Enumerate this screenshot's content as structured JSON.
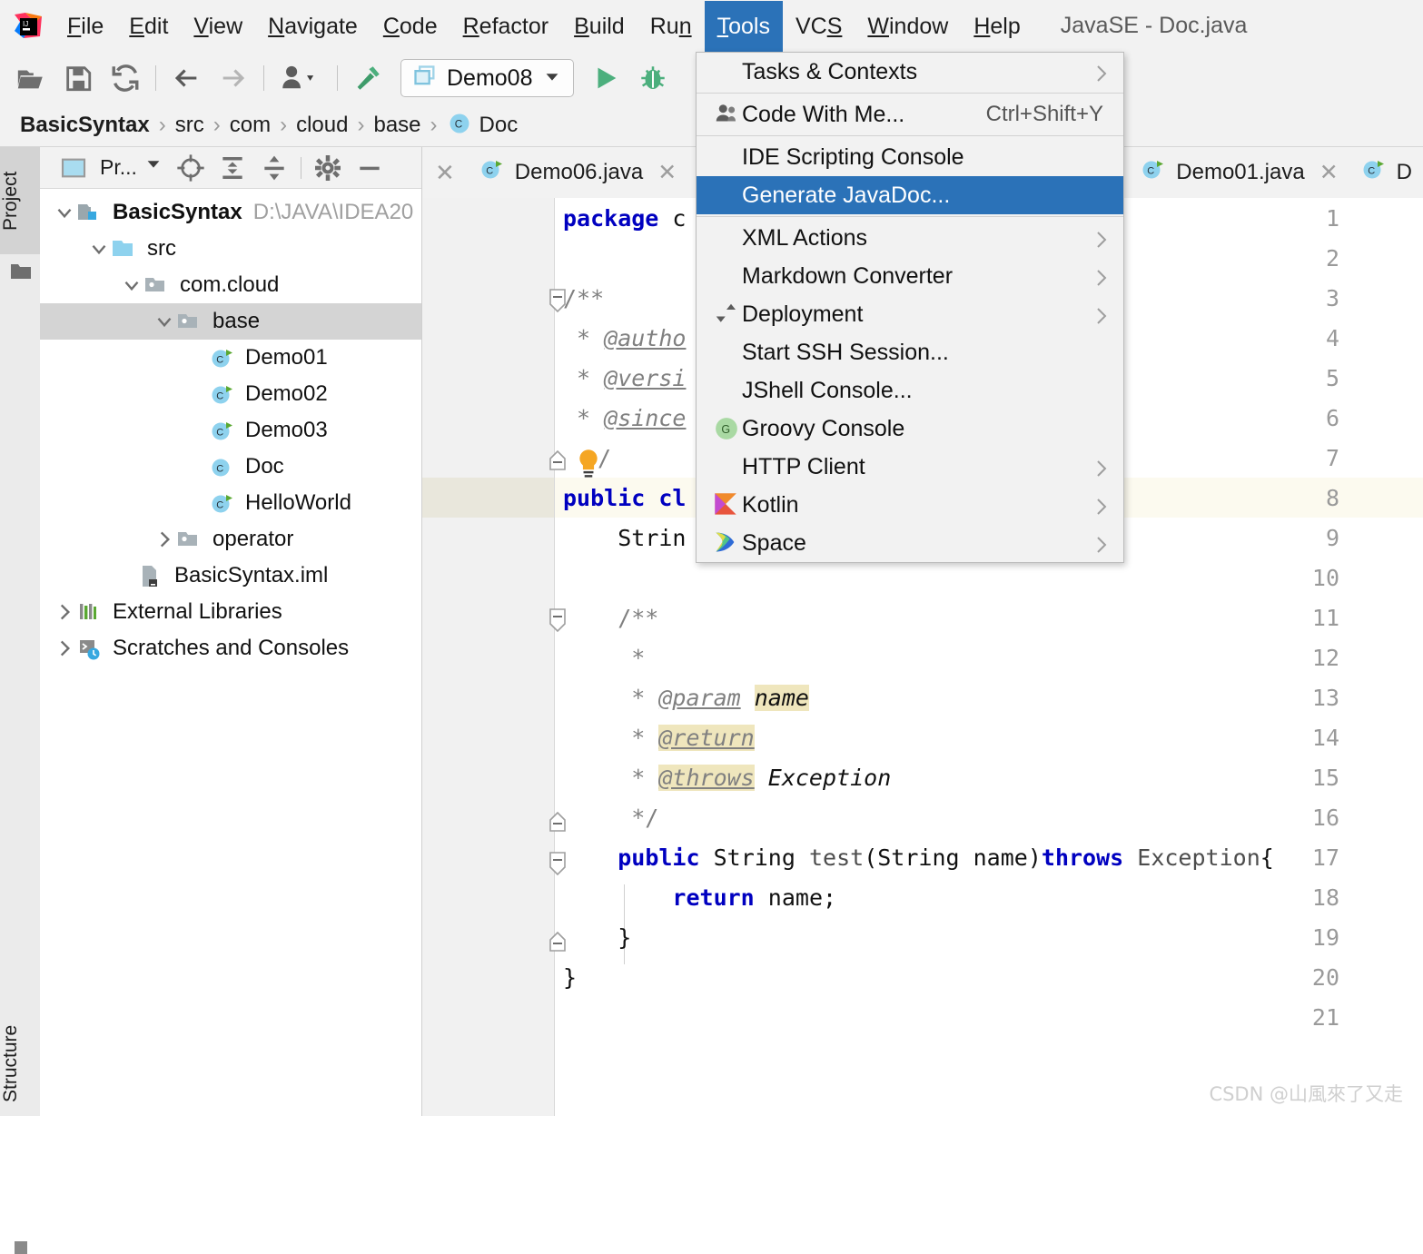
{
  "window": {
    "title": "JavaSE - Doc.java",
    "accent_color": "#8a7be0",
    "highlight_color": "#2b72b8"
  },
  "menubar": {
    "logo_icon": "intellij-idea-logo",
    "items": [
      {
        "label": "File",
        "mnemonic": "F"
      },
      {
        "label": "Edit",
        "mnemonic": "E"
      },
      {
        "label": "View",
        "mnemonic": "V"
      },
      {
        "label": "Navigate",
        "mnemonic": "N"
      },
      {
        "label": "Code",
        "mnemonic": "C"
      },
      {
        "label": "Refactor",
        "mnemonic": "R"
      },
      {
        "label": "Build",
        "mnemonic": "B"
      },
      {
        "label": "Run",
        "mnemonic": "n"
      },
      {
        "label": "Tools",
        "mnemonic": "T",
        "active": true
      },
      {
        "label": "VCS",
        "mnemonic": "S"
      },
      {
        "label": "Window",
        "mnemonic": "W"
      },
      {
        "label": "Help",
        "mnemonic": "H"
      }
    ]
  },
  "toolbar": {
    "icons": [
      "open-folder-icon",
      "save-all-icon",
      "sync-refresh-icon",
      "back-arrow-icon",
      "forward-arrow-icon",
      "profile-dropdown-icon",
      "build-hammer-icon"
    ],
    "run_config": {
      "icon": "run-configuration-icon",
      "label": "Demo08",
      "dropdown_icon": "chevron-down-icon"
    },
    "run_icon": "run-play-icon",
    "debug_icon": "debug-bug-icon"
  },
  "breadcrumb": {
    "separator": "›",
    "items": [
      {
        "label": "BasicSyntax",
        "bold": true
      },
      {
        "label": "src"
      },
      {
        "label": "com"
      },
      {
        "label": "cloud"
      },
      {
        "label": "base"
      },
      {
        "label": "Doc",
        "icon": "java-class-icon"
      }
    ]
  },
  "left_strip": {
    "project_tab": "Project",
    "structure_tab": "Structure",
    "favorites_icon": "favorites-folder-icon"
  },
  "project_panel": {
    "toolbar": {
      "view_icon": "project-view-icon",
      "view_label": "Pr...",
      "dropdown_icon": "chevron-down-icon",
      "locate_icon": "scroll-from-source-icon",
      "expand_icon": "expand-all-icon",
      "collapse_icon": "collapse-all-icon",
      "settings_icon": "gear-icon",
      "hide_icon": "minimize-icon"
    },
    "tree": [
      {
        "label": "BasicSyntax",
        "path": "D:\\JAVA\\IDEA20",
        "depth": 0,
        "arrow": "down",
        "icon": "module-folder-icon",
        "bold": true
      },
      {
        "label": "src",
        "depth": 1,
        "arrow": "down",
        "icon": "source-folder-icon"
      },
      {
        "label": "com.cloud",
        "depth": 2,
        "arrow": "down",
        "icon": "package-icon"
      },
      {
        "label": "base",
        "depth": 3,
        "arrow": "down",
        "icon": "package-icon",
        "selected": true
      },
      {
        "label": "Demo01",
        "depth": 4,
        "arrow": "none",
        "icon": "java-runnable-class-icon"
      },
      {
        "label": "Demo02",
        "depth": 4,
        "arrow": "none",
        "icon": "java-runnable-class-icon"
      },
      {
        "label": "Demo03",
        "depth": 4,
        "arrow": "none",
        "icon": "java-runnable-class-icon"
      },
      {
        "label": "Doc",
        "depth": 4,
        "arrow": "none",
        "icon": "java-class-icon"
      },
      {
        "label": "HelloWorld",
        "depth": 4,
        "arrow": "none",
        "icon": "java-runnable-class-icon"
      },
      {
        "label": "operator",
        "depth": 3,
        "arrow": "right",
        "icon": "package-icon"
      },
      {
        "label": "BasicSyntax.iml",
        "depth": 2,
        "arrow": "none",
        "icon": "iml-file-icon"
      },
      {
        "label": "External Libraries",
        "depth": 0,
        "arrow": "right",
        "icon": "libraries-icon"
      },
      {
        "label": "Scratches and Consoles",
        "depth": 0,
        "arrow": "right",
        "icon": "scratches-icon"
      }
    ]
  },
  "editor_tabs": [
    {
      "label": "Demo06.java",
      "icon": "java-runnable-class-icon",
      "close_icon": "close-icon",
      "active": false
    },
    {
      "label": "Demo01.java",
      "icon": "java-runnable-class-icon",
      "close_icon": "close-icon",
      "active": false
    },
    {
      "label": "D",
      "icon": "java-runnable-class-icon",
      "active": false
    }
  ],
  "editor": {
    "current_line": 8,
    "line_numbers": [
      1,
      2,
      3,
      4,
      5,
      6,
      7,
      8,
      9,
      10,
      11,
      12,
      13,
      14,
      15,
      16,
      17,
      18,
      19,
      20,
      21
    ],
    "code": [
      {
        "n": 1,
        "text": "package c"
      },
      {
        "n": 2,
        "text": ""
      },
      {
        "n": 3,
        "text": "/**"
      },
      {
        "n": 4,
        "text": " * @autho"
      },
      {
        "n": 5,
        "text": " * @versi"
      },
      {
        "n": 6,
        "text": " * @since"
      },
      {
        "n": 7,
        "text": " */"
      },
      {
        "n": 8,
        "text": "public cl"
      },
      {
        "n": 9,
        "text": "    Strin"
      },
      {
        "n": 10,
        "text": ""
      },
      {
        "n": 11,
        "text": "    /**"
      },
      {
        "n": 12,
        "text": "     *"
      },
      {
        "n": 13,
        "text": "     * @param name"
      },
      {
        "n": 14,
        "text": "     * @return"
      },
      {
        "n": 15,
        "text": "     * @throws Exception"
      },
      {
        "n": 16,
        "text": "     */"
      },
      {
        "n": 17,
        "text": "    public String test(String name)throws Exception{"
      },
      {
        "n": 18,
        "text": "        return name;"
      },
      {
        "n": 19,
        "text": "    }"
      },
      {
        "n": 20,
        "text": "}"
      },
      {
        "n": 21,
        "text": ""
      }
    ],
    "intention_bulb_icon": "lightbulb-icon"
  },
  "tools_menu": {
    "items": [
      {
        "label": "Tasks & Contexts",
        "mnemonic": "T",
        "submenu": true
      },
      {
        "separator": true
      },
      {
        "label": "Code With Me...",
        "icon": "people-icon",
        "accel": "Ctrl+Shift+Y"
      },
      {
        "separator": true
      },
      {
        "label": "IDE Scripting Console"
      },
      {
        "label": "Generate JavaDoc...",
        "mnemonic": "D",
        "selected": true
      },
      {
        "separator": true
      },
      {
        "label": "XML Actions",
        "submenu": true
      },
      {
        "label": "Markdown Converter",
        "submenu": true
      },
      {
        "label": "Deployment",
        "mnemonic": "e",
        "icon": "deployment-arrows-icon",
        "submenu": true
      },
      {
        "label": "Start SSH Session..."
      },
      {
        "label": "JShell Console..."
      },
      {
        "label": "Groovy Console",
        "icon": "groovy-icon"
      },
      {
        "label": "HTTP Client",
        "submenu": true
      },
      {
        "label": "Kotlin",
        "icon": "kotlin-icon",
        "submenu": true
      },
      {
        "label": "Space",
        "icon": "space-icon",
        "submenu": true
      }
    ]
  },
  "watermark": "CSDN @山風來了又走"
}
